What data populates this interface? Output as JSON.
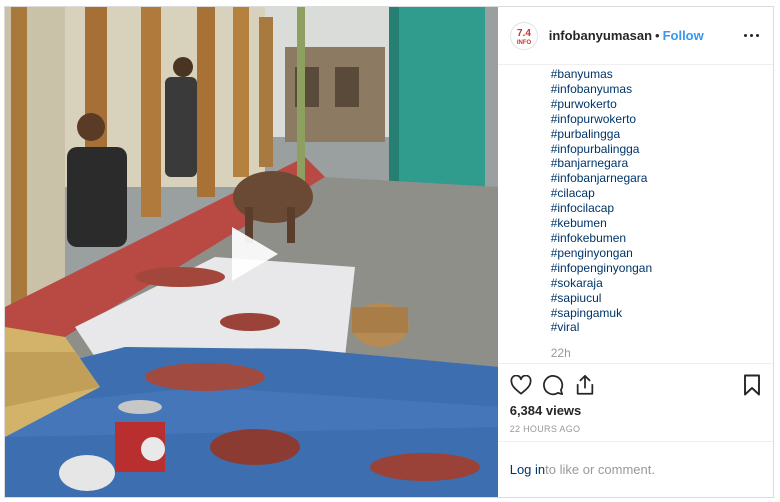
{
  "post": {
    "username": "infobanyumasan",
    "separator": "•",
    "follow_label": "Follow",
    "avatar_logo_text": "INFO"
  },
  "caption": {
    "hashtags": [
      "#banyumas",
      "#infobanyumas",
      "#purwokerto",
      "#infopurwokerto",
      "#purbalingga",
      "#infopurbalingga",
      "#banjarnegara",
      "#infobanjarnegara",
      "#cilacap",
      "#infocilacap",
      "#kebumen",
      "#infokebumen",
      "#penginyongan",
      "#infopenginyongan",
      "#sokaraja",
      "#sapiucul",
      "#sapingamuk",
      "#viral"
    ],
    "relative_time": "22h"
  },
  "stats": {
    "views": "6,384 views",
    "timestamp": "22 hours ago"
  },
  "footer": {
    "login_link": "Log in",
    "login_suffix": " to like or comment."
  },
  "icons": {
    "play": "play-icon",
    "like": "heart-icon",
    "comment": "comment-icon",
    "share": "share-icon",
    "save": "bookmark-icon",
    "more": "more-options-icon"
  },
  "colors": {
    "link_blue": "#3897f0",
    "hashtag": "#003569",
    "muted": "#999999",
    "border": "#dbdbdb",
    "tarp_blue": "#3d6fb0"
  }
}
